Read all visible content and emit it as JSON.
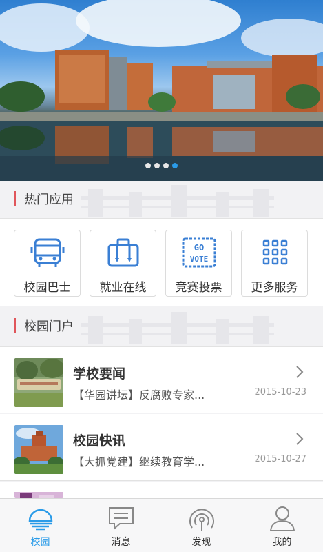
{
  "banner": {
    "slide_count": 4,
    "active_slide": 4
  },
  "hot_apps": {
    "title": "热门应用",
    "items": [
      {
        "label": "校园巴士",
        "icon": "bus-icon"
      },
      {
        "label": "就业在线",
        "icon": "briefcase-icon"
      },
      {
        "label": "竞赛投票",
        "icon": "go-vote-icon",
        "icon_text_top": "GO",
        "icon_text_bottom": "VOTE"
      },
      {
        "label": "更多服务",
        "icon": "grid-icon"
      }
    ]
  },
  "portal": {
    "title": "校园门户",
    "items": [
      {
        "title": "学校要闻",
        "summary": "【华园讲坛】反腐败专家...",
        "date": "2015-10-23"
      },
      {
        "title": "校园快讯",
        "summary": "【大抓党建】继续教育学...",
        "date": "2015-10-27"
      }
    ]
  },
  "tabbar": {
    "tabs": [
      {
        "label": "校园",
        "icon": "campus-icon",
        "active": true
      },
      {
        "label": "消息",
        "icon": "message-icon",
        "active": false
      },
      {
        "label": "发现",
        "icon": "discover-icon",
        "active": false
      },
      {
        "label": "我的",
        "icon": "profile-icon",
        "active": false
      }
    ]
  },
  "colors": {
    "accent": "#2a9be8",
    "section_bar": "#e0565b",
    "icon_blue": "#3a7fd4"
  }
}
